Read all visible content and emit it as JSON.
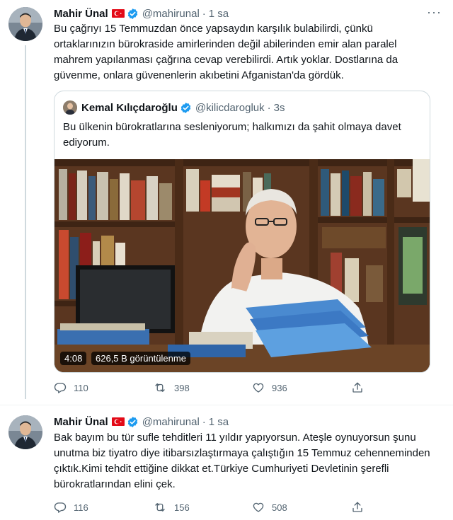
{
  "tweets": [
    {
      "author_name": "Mahir Ünal",
      "handle": "@mahirunal",
      "separator": "·",
      "time": "1 sa",
      "more": "···",
      "text": "Bu çağrıyı 15 Temmuzdan önce yapsaydın karşılık bulabilirdi, çünkü ortaklarınızın bürokraside amirlerinden değil abilerinden emir alan paralel mahrem yapılanması çağrına cevap verebilirdi. Artık yoklar. Dostlarına da güvenme, onlara güvenenlerin akıbetini Afganistan'da gördük.",
      "replies": "110",
      "retweets": "398",
      "likes": "936",
      "quote": {
        "author_name": "Kemal Kılıçdaroğlu",
        "handle": "@kilicdarogluk",
        "separator": "·",
        "time": "3s",
        "text": "Bu ülkenin bürokratlarına sesleniyorum; halkımızı da şahit olmaya davet ediyorum.",
        "video_duration": "4:08",
        "video_views": "626,5 B görüntülenme"
      }
    },
    {
      "author_name": "Mahir Ünal",
      "handle": "@mahirunal",
      "separator": "·",
      "time": "1 sa",
      "text": "Bak bayım bu tür sufle tehditleri 11 yıldır yapıyorsun. Ateşle oynuyorsun şunu unutma biz tiyatro diye itibarsızlaştırmaya çalıştığın 15 Temmuz cehenneminden çıktık.Kimi tehdit ettiğine dikkat et.Türkiye Cumhuriyeti Devletinin şerefli bürokratlarından elini çek.",
      "replies": "116",
      "retweets": "156",
      "likes": "508"
    }
  ],
  "icons": {
    "reply": "reply-icon",
    "retweet": "retweet-icon",
    "like": "heart-icon",
    "share": "share-icon",
    "verified": "verified-badge-icon",
    "flag": "turkey-flag-icon"
  },
  "colors": {
    "text_primary": "#0f1419",
    "text_secondary": "#536471",
    "verified_blue": "#1d9bf0",
    "border": "#cfd9de",
    "flag_red": "#e30a17"
  }
}
